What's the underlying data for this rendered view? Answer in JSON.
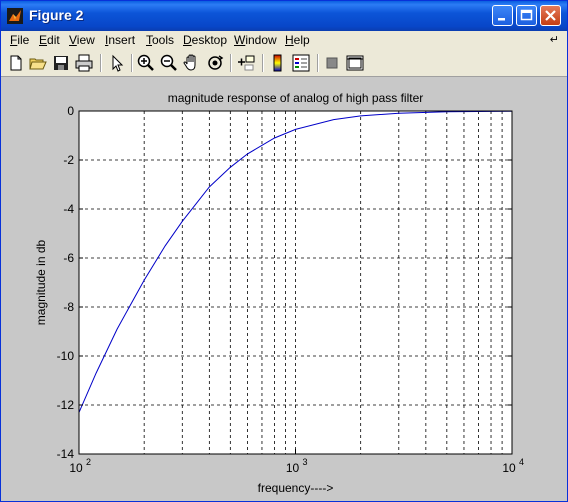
{
  "window": {
    "title": "Figure 2"
  },
  "menu": [
    "File",
    "Edit",
    "View",
    "Insert",
    "Tools",
    "Desktop",
    "Window",
    "Help"
  ],
  "menu_underline": [
    "F",
    "E",
    "V",
    "I",
    "T",
    "D",
    "W",
    "H"
  ],
  "toolbar_icons": [
    "new-figure-icon",
    "open-file-icon",
    "save-icon",
    "print-icon",
    "edit-plot-arrow-icon",
    "zoom-in-icon",
    "zoom-out-icon",
    "pan-hand-icon",
    "rotate-3d-icon",
    "data-cursor-icon",
    "colorbar-icon",
    "legend-icon",
    "hide-plot-tools-icon",
    "show-plot-tools-icon"
  ],
  "colors": {
    "line": "#0000c8",
    "axes_bg": "#ffffff",
    "figure_bg": "#c8c8c8",
    "titlebar": "#0a5fe0"
  },
  "chart_data": {
    "type": "line",
    "title": "magnitude response of analog of high pass filter",
    "xlabel": "frequency---->",
    "ylabel": "magnitude in db",
    "xscale": "log",
    "xlim": [
      100,
      10000
    ],
    "ylim": [
      -14,
      0
    ],
    "grid": "on (dashed)",
    "ytick_labels": [
      "0",
      "-2",
      "-4",
      "-6",
      "-8",
      "-10",
      "-12",
      "-14"
    ],
    "xtick_labels": [
      {
        "base": "10",
        "exp": "2"
      },
      {
        "base": "10",
        "exp": "3"
      },
      {
        "base": "10",
        "exp": "4"
      }
    ],
    "series": [
      {
        "x": [
          100,
          120,
          150,
          200,
          250,
          300,
          400,
          500,
          600,
          800,
          1000,
          1500,
          2000,
          3000,
          5000,
          10000
        ],
        "y": [
          -12.3,
          -10.7,
          -8.9,
          -6.9,
          -5.5,
          -4.5,
          -3.1,
          -2.3,
          -1.75,
          -1.1,
          -0.75,
          -0.35,
          -0.2,
          -0.09,
          -0.03,
          -0.01
        ]
      }
    ]
  }
}
